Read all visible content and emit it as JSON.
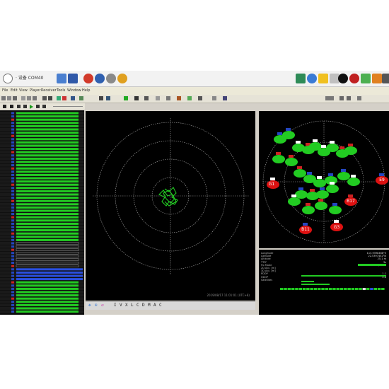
{
  "window": {
    "title": "· 设备  COM40",
    "app_icon": "gps-globe-icon"
  },
  "menubar": {
    "items": [
      "File",
      "Edit",
      "View",
      "Player",
      "Receiver",
      "Tools",
      "Window",
      "Help"
    ]
  },
  "toolbar_icons": {
    "left": [
      "connect-icon",
      "save-icon",
      "record-icon",
      "stop-icon",
      "settings-icon",
      "globe-icon"
    ],
    "right": [
      "map-icon",
      "globe-icon",
      "sun-icon",
      "signal-icon",
      "star-icon",
      "recorder-icon",
      "satellite-icon",
      "graph-icon",
      "camera-icon"
    ]
  },
  "center_panel": {
    "mode_letters": [
      "I",
      "V",
      "X",
      "L",
      "C",
      "D",
      "M",
      "A",
      "C"
    ],
    "footer_text": "2019/08/17 11:01:01 (UTC+8)"
  },
  "sky_view": {
    "satellites": [
      {
        "id": "G1",
        "status": "lost"
      },
      {
        "id": "B11",
        "status": "lost"
      },
      {
        "id": "B17",
        "status": "lost"
      },
      {
        "id": "G3",
        "status": "lost"
      },
      {
        "id": "E9",
        "status": "lost"
      }
    ]
  },
  "info_panel": {
    "rows": [
      {
        "label": "Longitude",
        "value": "113.9398468°E"
      },
      {
        "label": "Latitude",
        "value": "22.5397452°N"
      },
      {
        "label": "Altitude",
        "value": "25.1 m"
      },
      {
        "label": "TTFF",
        "value": "3s"
      },
      {
        "label": "Fix Mode",
        "value": "3D/DGPS"
      },
      {
        "label": "2D Acc. [m]",
        "value": ""
      },
      {
        "label": "3D Acc. [m]",
        "value": ""
      },
      {
        "label": "PDOP",
        "value": "1.1"
      },
      {
        "label": "HDOP",
        "value": "0.8"
      },
      {
        "label": "Satellites",
        "value": ""
      }
    ]
  },
  "colors": {
    "signal_green": "#22cc22",
    "lost_red": "#dd1111",
    "grid_white": "#aaaaaa",
    "background": "#000000"
  }
}
